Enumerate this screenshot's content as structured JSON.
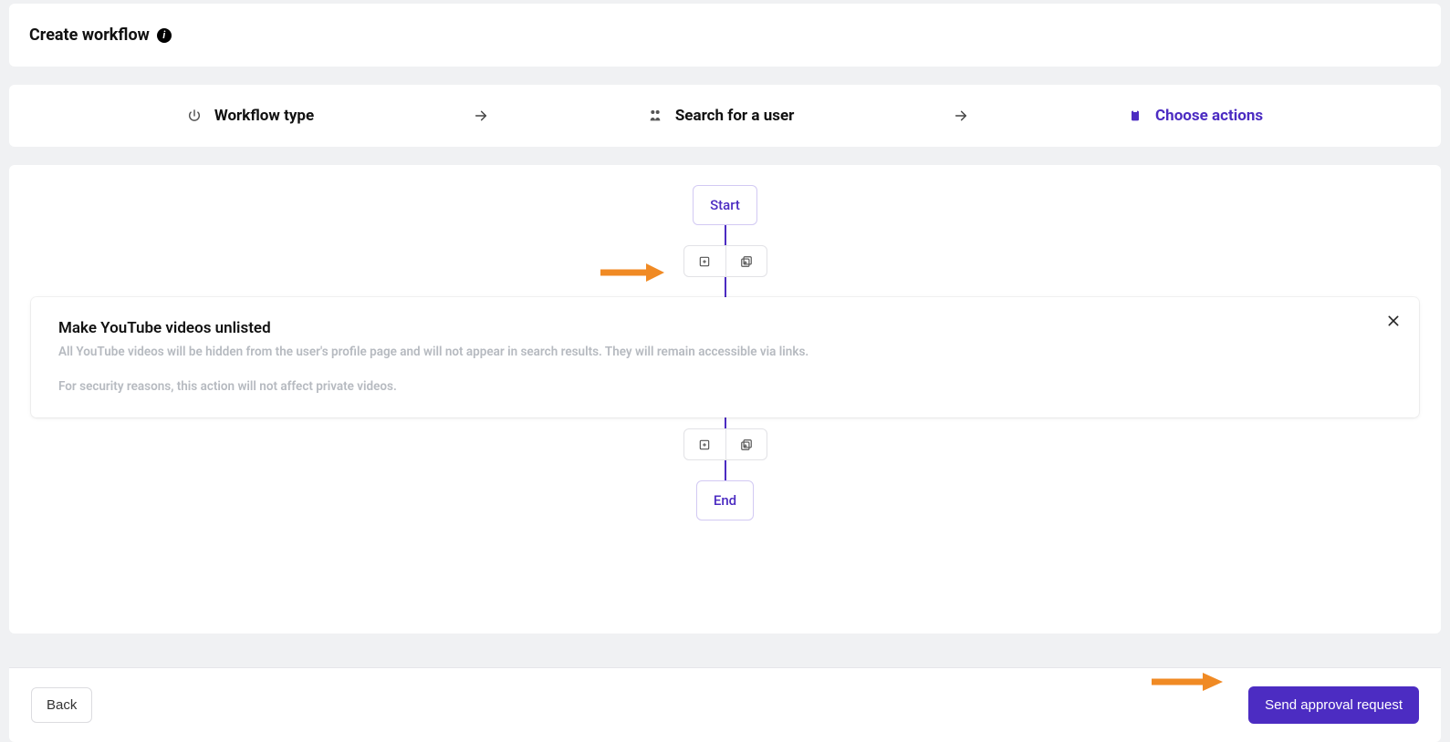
{
  "header": {
    "title": "Create workflow"
  },
  "stepper": {
    "steps": [
      {
        "label": "Workflow type",
        "active": false
      },
      {
        "label": "Search for a user",
        "active": false
      },
      {
        "label": "Choose actions",
        "active": true
      }
    ]
  },
  "flow": {
    "start_label": "Start",
    "end_label": "End"
  },
  "action": {
    "title": "Make YouTube videos unlisted",
    "description": "All YouTube videos will be hidden from the user's profile page and will not appear in search results. They will remain accessible via links.",
    "note": "For security reasons, this action will not affect private videos."
  },
  "footer": {
    "back_label": "Back",
    "submit_label": "Send approval request"
  },
  "colors": {
    "primary": "#4c2cc2",
    "annotation": "#f08a24"
  }
}
